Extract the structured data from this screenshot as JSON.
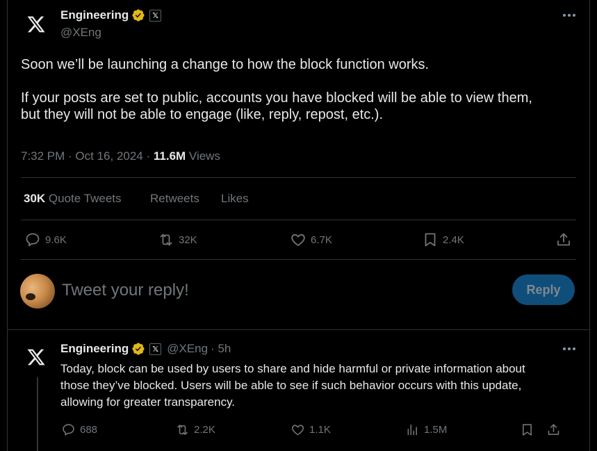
{
  "main_tweet": {
    "author": {
      "name": "Engineering",
      "handle": "@XEng",
      "verified_badge": "gold-verified-badge",
      "affiliate_badge": "𝕏"
    },
    "more_icon": "more-horizontal-icon",
    "text_line1": "Soon we’ll be launching a change to how the block function works.",
    "text_para2_line1": "If your posts are set to public, accounts you have blocked will be able to view them,",
    "text_para2_line2": "but they will not be able to engage (like, reply, repost, etc.).",
    "timestamp": "7:32 PM · Oct 16, 2024 · ",
    "views_count": "11.6M",
    "views_label": " Views",
    "stats": {
      "quote_count": "30K",
      "quote_label": " Quote Tweets",
      "retweets_label": "Retweets",
      "likes_label": "Likes"
    },
    "actions": {
      "replies": "9.6K",
      "reposts": "32K",
      "likes": "6.7K",
      "bookmarks": "2.4K"
    }
  },
  "composer": {
    "placeholder": "Tweet your reply!",
    "reply_button": "Reply",
    "accent": "#0f4e7a"
  },
  "reply_tweet": {
    "author": {
      "name": "Engineering",
      "handle": "@XEng",
      "time": " · 5h",
      "affiliate_badge": "𝕏"
    },
    "text_line1": "Today, block can be used by users to share and hide harmful or private information about",
    "text_line2": "those they’ve blocked. Users will be able to see if such behavior occurs with this update,",
    "text_line3": "allowing for greater transparency.",
    "actions": {
      "replies": "688",
      "reposts": "2.2K",
      "likes": "1.1K",
      "views": "1.5M"
    }
  }
}
